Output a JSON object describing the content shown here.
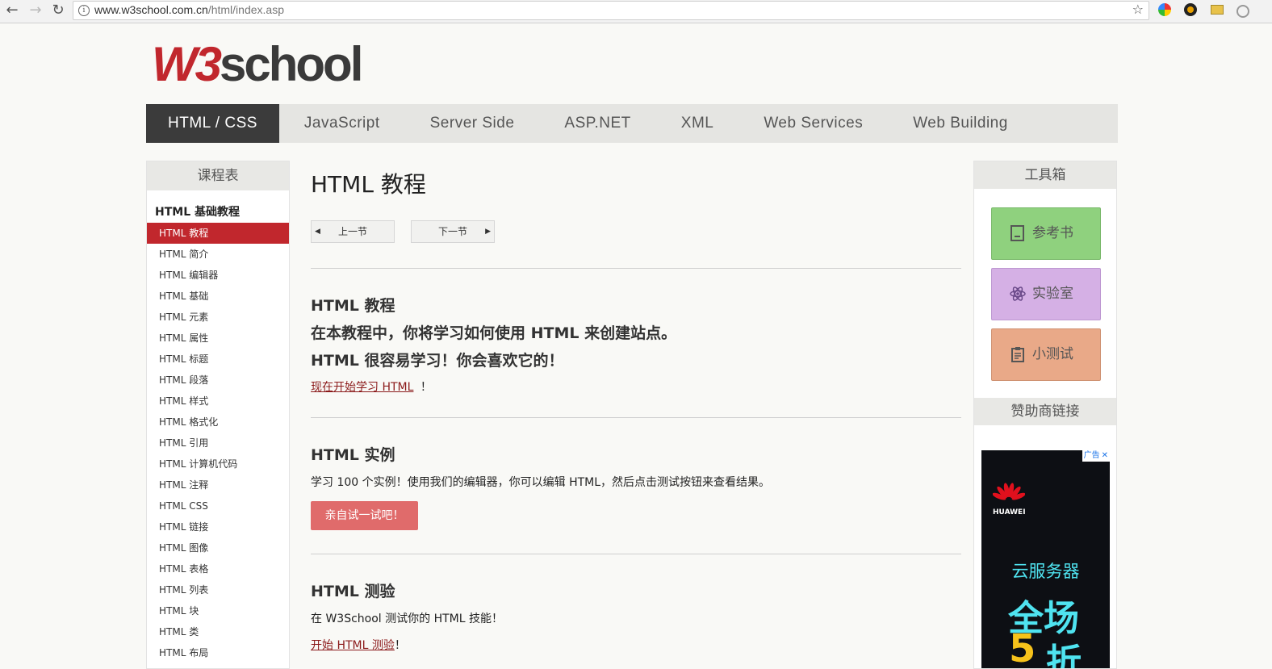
{
  "browser": {
    "back": "←",
    "forward": "→",
    "reload": "↻",
    "url_host": "www.w3school.com.cn",
    "url_path": "/html/index.asp",
    "bookmark": "☆",
    "extensions": [
      "color-wheel-icon",
      "camera-icon",
      "folder-icon",
      "circle-icon"
    ]
  },
  "logo": {
    "w3": "W3",
    "school": "school"
  },
  "topnav": {
    "items": [
      "HTML / CSS",
      "JavaScript",
      "Server Side",
      "ASP.NET",
      "XML",
      "Web Services",
      "Web Building"
    ],
    "active_index": 0
  },
  "sidebar": {
    "heading": "课程表",
    "subheading": "HTML 基础教程",
    "items": [
      "HTML 教程",
      "HTML 简介",
      "HTML 编辑器",
      "HTML 基础",
      "HTML 元素",
      "HTML 属性",
      "HTML 标题",
      "HTML 段落",
      "HTML 样式",
      "HTML 格式化",
      "HTML 引用",
      "HTML 计算机代码",
      "HTML 注释",
      "HTML CSS",
      "HTML 链接",
      "HTML 图像",
      "HTML 表格",
      "HTML 列表",
      "HTML 块",
      "HTML 类",
      "HTML 布局"
    ],
    "active_index": 0
  },
  "main": {
    "title": "HTML 教程",
    "prev_label": "上一节",
    "next_label": "下一节",
    "sec1": {
      "heading": "HTML 教程",
      "line1": "在本教程中，你将学习如何使用 HTML 来创建站点。",
      "line2": "HTML 很容易学习！你会喜欢它的！",
      "link": "现在开始学习 HTML",
      "link_suffix": "！"
    },
    "sec2": {
      "heading": "HTML 实例",
      "text": "学习 100 个实例！使用我们的编辑器，你可以编辑 HTML，然后点击测试按钮来查看结果。",
      "button": "亲自试一试吧！"
    },
    "sec3": {
      "heading": "HTML 测验",
      "text": "在 W3School 测试你的 HTML 技能！",
      "link": "开始 HTML 测验",
      "link_suffix": "！"
    }
  },
  "toolbox": {
    "heading": "工具箱",
    "reference": "参考书",
    "lab": "实验室",
    "quiz": "小测试",
    "sponsor_heading": "赞助商链接"
  },
  "ad": {
    "tag": "广告",
    "close": "✕",
    "brand": "HUAWEI",
    "headline": "云服务器",
    "big1": "全场",
    "big2": "5",
    "big3": "折"
  },
  "colors": {
    "brand_red": "#c1272d",
    "nav_active": "#3b3b3b",
    "reference_green": "#8fd17e",
    "lab_purple": "#d5b0e5",
    "quiz_orange": "#e9a988",
    "try_button": "#e06b6b"
  }
}
